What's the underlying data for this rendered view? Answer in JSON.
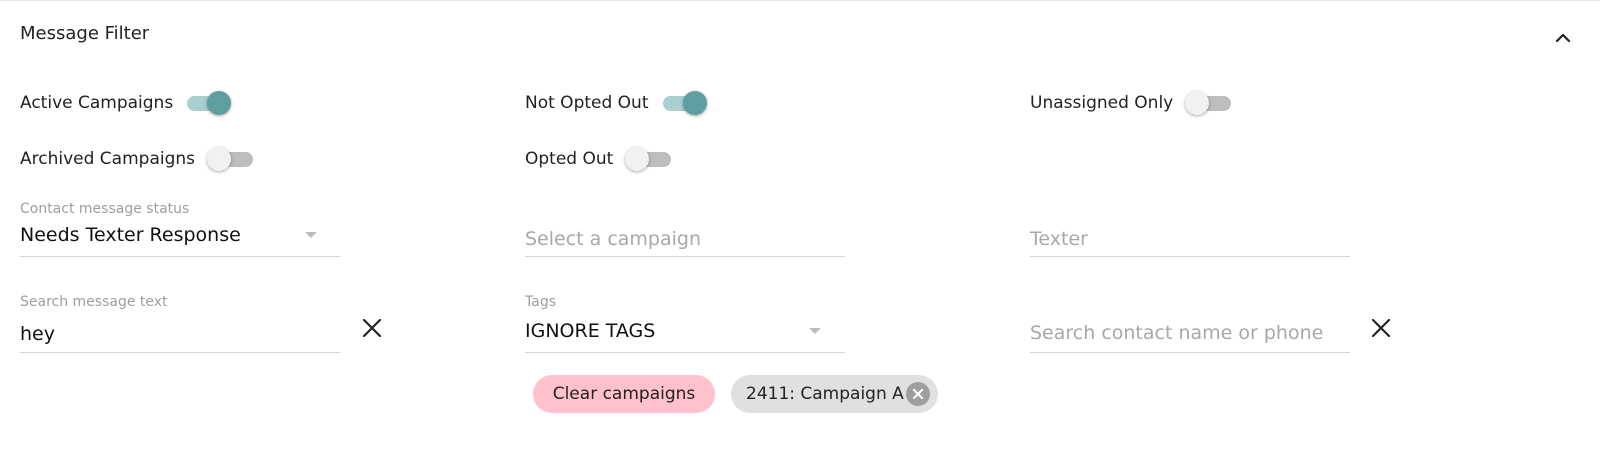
{
  "header": {
    "title": "Message Filter",
    "collapse_icon": "chevron-up-icon"
  },
  "toggles": {
    "active_campaigns": {
      "label": "Active Campaigns",
      "on": true
    },
    "not_opted_out": {
      "label": "Not Opted Out",
      "on": true
    },
    "unassigned_only": {
      "label": "Unassigned Only",
      "on": false
    },
    "archived_campaigns": {
      "label": "Archived Campaigns",
      "on": false
    },
    "opted_out": {
      "label": "Opted Out",
      "on": false
    }
  },
  "fields": {
    "contact_status": {
      "label": "Contact message status",
      "value": "Needs Texter Response"
    },
    "campaign": {
      "placeholder": "Select a campaign"
    },
    "texter": {
      "placeholder": "Texter"
    },
    "search_message": {
      "label": "Search message text",
      "value": "hey"
    },
    "tags": {
      "label": "Tags",
      "value": "IGNORE TAGS"
    },
    "search_contact": {
      "placeholder": "Search contact name or phone"
    }
  },
  "chips": {
    "clear_campaigns": "Clear campaigns",
    "selected_campaign": "2411: Campaign A"
  },
  "colors": {
    "toggle_on_thumb": "#5f9ea0",
    "toggle_on_track": "#a9cfd1",
    "clear_chip_bg": "#ffc1cc",
    "campaign_chip_bg": "#e0e0e0"
  }
}
